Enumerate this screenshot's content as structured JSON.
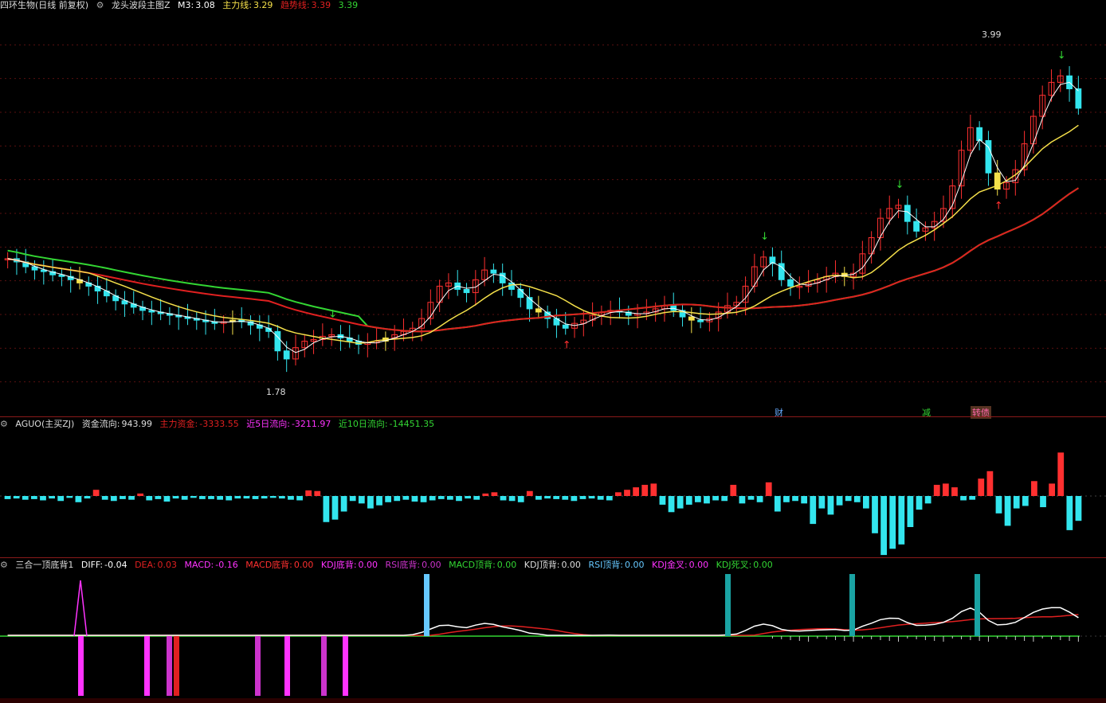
{
  "header": {
    "stock": "四环生物(日线 前复权)",
    "indicator": "龙头波段主图Z",
    "m3_label": "M3:",
    "m3_value": "3.08",
    "main_label": "主力线:",
    "main_value": "3.29",
    "trend_label": "趋势线:",
    "trend_value": "3.39",
    "extra_value": "3.39"
  },
  "price_labels": {
    "high": "3.99",
    "low": "1.78"
  },
  "event_tags": {
    "cai": "财",
    "jian": "减",
    "gai": "转债"
  },
  "flow_header": {
    "name": "AGUO(主买ZJ)",
    "flow_label": "资金流向:",
    "flow_value": "943.99",
    "main_label": "主力资金:",
    "main_value": "-3333.55",
    "d5_label": "近5日流向:",
    "d5_value": "-3211.97",
    "d10_label": "近10日流向:",
    "d10_value": "-14451.35"
  },
  "macd_header": {
    "name": "三合一顶底背1",
    "diff_label": "DIFF:",
    "diff_value": "-0.04",
    "dea_label": "DEA:",
    "dea_value": "0.03",
    "macd_label": "MACD:",
    "macd_value": "-0.16",
    "macd_bottom_label": "MACD底背:",
    "macd_bottom_value": "0.00",
    "kdj_bottom_label": "KDJ底背:",
    "kdj_bottom_value": "0.00",
    "rsi_bottom_label": "RSI底背:",
    "rsi_bottom_value": "0.00",
    "macd_top_label": "MACD顶背:",
    "macd_top_value": "0.00",
    "kdj_top_label": "KDJ顶背:",
    "kdj_top_value": "0.00",
    "rsi_top_label": "RSI顶背:",
    "rsi_top_value": "0.00",
    "kdj_gold_label": "KDJ金叉:",
    "kdj_gold_value": "0.00",
    "kdj_dead_label": "KDJ死叉:",
    "kdj_dead_value": "0.00"
  },
  "colors": {
    "up": "#ff3030",
    "down": "#33e5ee",
    "yellow": "#f5e04a",
    "white": "#ffffff",
    "green": "#33d633",
    "red_line": "#e02020",
    "magenta": "#ff33ff",
    "blue": "#2030ff",
    "teal": "#1aa3a3",
    "light_blue": "#66c8ff",
    "purple": "#cc33cc"
  },
  "chart_data": [
    {
      "type": "candlestick",
      "title": "龙头波段主图Z",
      "x_count": 120,
      "ylim": [
        1.6,
        4.1
      ],
      "close": [
        2.57,
        2.55,
        2.52,
        2.5,
        2.49,
        2.47,
        2.46,
        2.44,
        2.42,
        2.4,
        2.37,
        2.34,
        2.31,
        2.29,
        2.27,
        2.25,
        2.24,
        2.23,
        2.22,
        2.21,
        2.2,
        2.19,
        2.18,
        2.17,
        2.18,
        2.19,
        2.18,
        2.16,
        2.14,
        2.12,
        2.0,
        1.95,
        2.02,
        2.06,
        2.07,
        2.09,
        2.1,
        2.08,
        2.06,
        2.04,
        2.05,
        2.06,
        2.08,
        2.1,
        2.12,
        2.14,
        2.2,
        2.3,
        2.4,
        2.42,
        2.38,
        2.36,
        2.44,
        2.5,
        2.48,
        2.42,
        2.38,
        2.33,
        2.26,
        2.24,
        2.2,
        2.16,
        2.14,
        2.17,
        2.19,
        2.22,
        2.24,
        2.25,
        2.24,
        2.22,
        2.23,
        2.24,
        2.26,
        2.28,
        2.25,
        2.21,
        2.19,
        2.18,
        2.2,
        2.24,
        2.28,
        2.3,
        2.4,
        2.52,
        2.58,
        2.54,
        2.44,
        2.4,
        2.4,
        2.42,
        2.44,
        2.46,
        2.48,
        2.46,
        2.48,
        2.6,
        2.7,
        2.82,
        2.88,
        2.9,
        2.8,
        2.74,
        2.76,
        2.8,
        2.88,
        3.02,
        3.24,
        3.38,
        3.3,
        3.1,
        3.0,
        3.04,
        3.12,
        3.28,
        3.45,
        3.58,
        3.66,
        3.7,
        3.62,
        3.5
      ],
      "lines": [
        {
          "name": "M3",
          "color": "white"
        },
        {
          "name": "主力线",
          "color": "yellow"
        },
        {
          "name": "趋势线",
          "color": "red_line"
        }
      ],
      "high_label": 3.99,
      "low_label": 1.78
    },
    {
      "type": "bar",
      "title": "AGUO(主买ZJ)",
      "ylim": [
        -100,
        100
      ],
      "values": [
        -5,
        -4,
        -6,
        -5,
        -7,
        -4,
        -8,
        -3,
        -10,
        -4,
        10,
        -6,
        -8,
        -5,
        -6,
        4,
        -7,
        -5,
        -9,
        -4,
        -6,
        -3,
        -5,
        -5,
        -6,
        -7,
        -4,
        -4,
        -5,
        -4,
        -3,
        -4,
        -6,
        -7,
        9,
        8,
        -42,
        -38,
        -25,
        -8,
        -12,
        -20,
        -15,
        -10,
        -8,
        -6,
        -9,
        -10,
        -7,
        -5,
        -6,
        -8,
        -4,
        -6,
        4,
        6,
        -7,
        -8,
        -10,
        8,
        -6,
        -4,
        -5,
        -6,
        -8,
        -5,
        -4,
        -6,
        -7,
        6,
        10,
        14,
        18,
        20,
        -14,
        -26,
        -20,
        -14,
        -10,
        -12,
        -7,
        -8,
        18,
        -12,
        -6,
        -10,
        22,
        -25,
        -10,
        -8,
        -12,
        -45,
        -20,
        -30,
        -15,
        -8,
        -10,
        -20,
        -60,
        -95,
        -85,
        -78,
        -50,
        -22,
        -12,
        18,
        20,
        14,
        -7,
        -6,
        28,
        40,
        -28,
        -48,
        -20,
        -16,
        24,
        -18,
        20,
        70,
        -55,
        -40
      ],
      "series": [
        {
          "name": "资金流向"
        }
      ]
    },
    {
      "type": "line",
      "title": "三合一顶底背1",
      "ylim": [
        -0.5,
        1.0
      ],
      "series": [
        {
          "name": "DIFF",
          "color": "white"
        },
        {
          "name": "DEA",
          "color": "red_line"
        },
        {
          "name": "MACD",
          "color": "magenta"
        }
      ]
    }
  ]
}
